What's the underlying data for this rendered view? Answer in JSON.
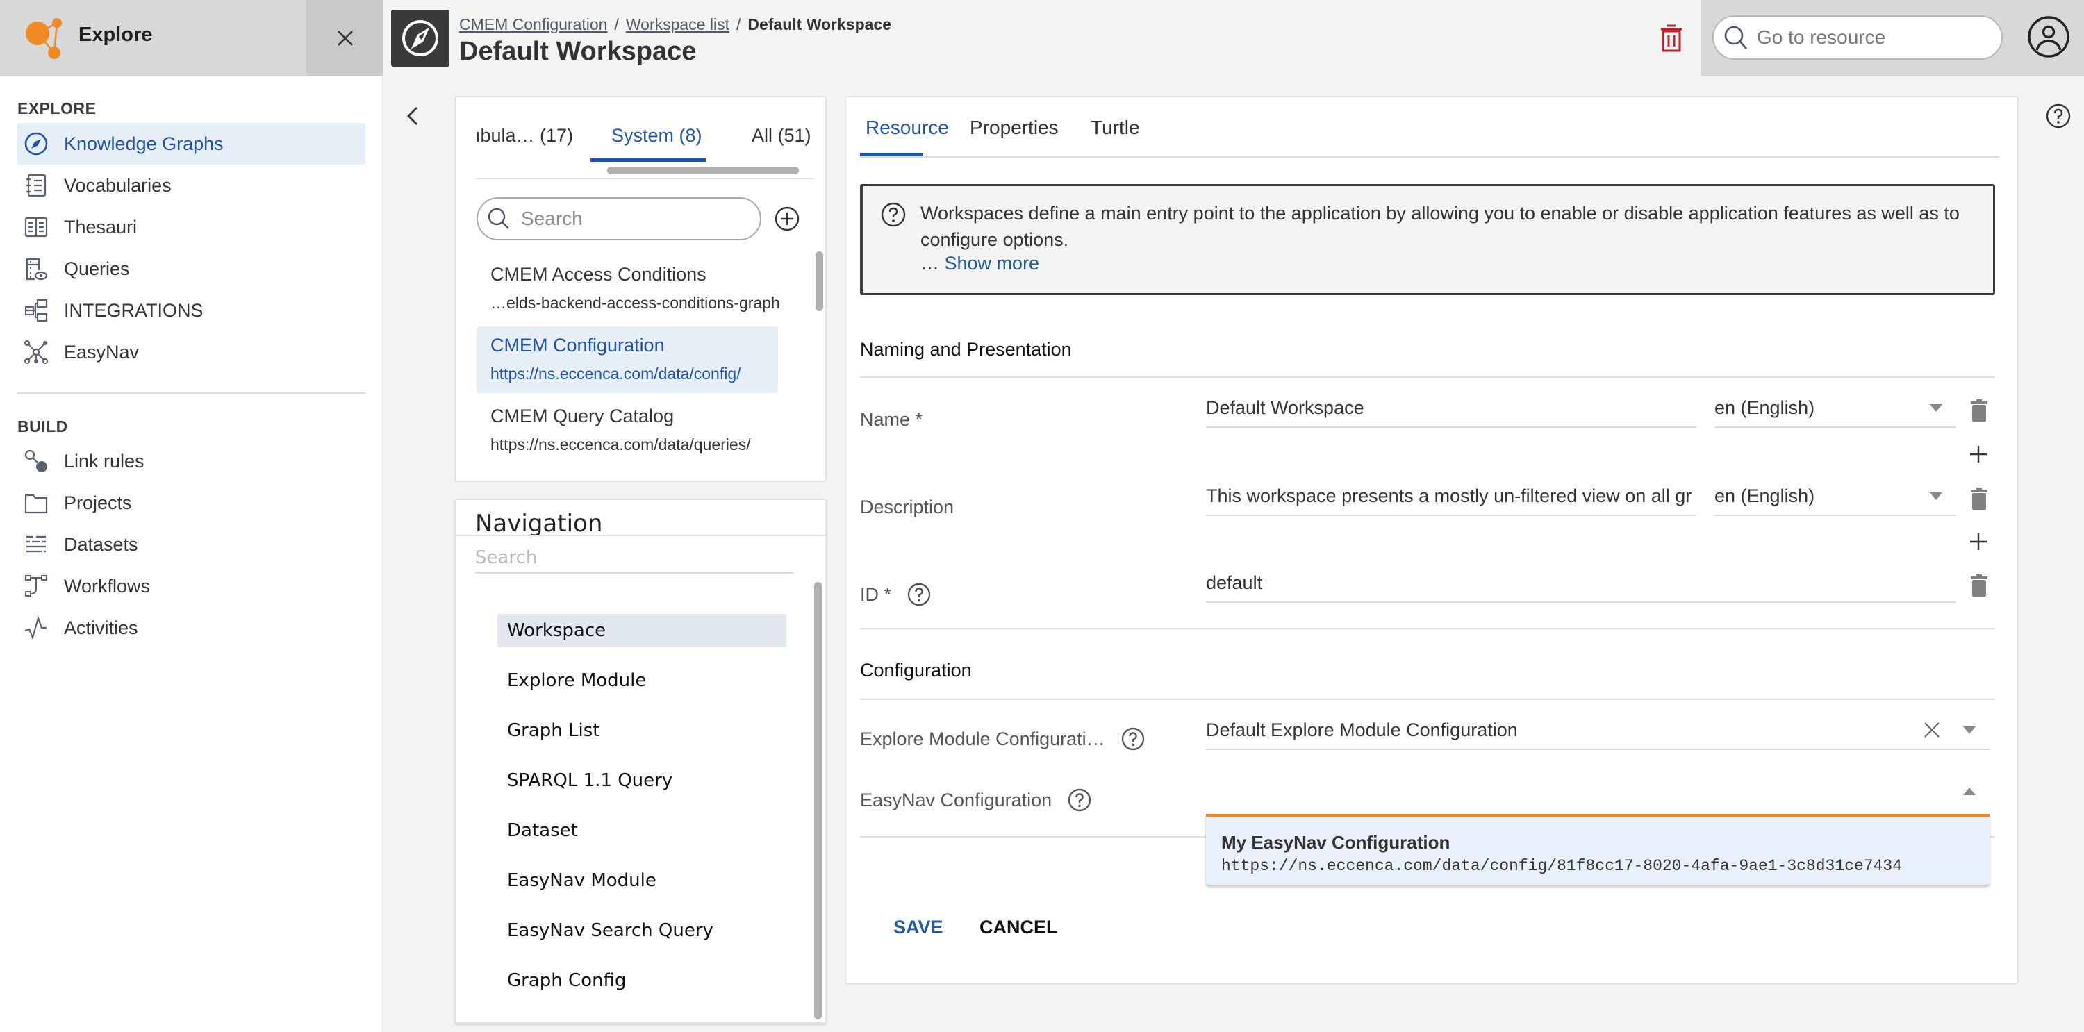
{
  "app": {
    "name": "Explore",
    "accent_color": "#f08a24",
    "primary_color": "#2453a4"
  },
  "sidebar": {
    "sections": [
      {
        "title": "EXPLORE",
        "items": [
          {
            "label": "Knowledge Graphs",
            "icon": "compass-icon",
            "active": true
          },
          {
            "label": "Vocabularies",
            "icon": "notebook-icon"
          },
          {
            "label": "Thesauri",
            "icon": "book-columns-icon"
          },
          {
            "label": "Queries",
            "icon": "query-eye-icon"
          },
          {
            "label": "INTEGRATIONS",
            "icon": "integrations-icon"
          },
          {
            "label": "EasyNav",
            "icon": "graph-network-icon"
          }
        ]
      },
      {
        "title": "BUILD",
        "items": [
          {
            "label": "Link rules",
            "icon": "link-rules-icon"
          },
          {
            "label": "Projects",
            "icon": "folder-icon"
          },
          {
            "label": "Datasets",
            "icon": "dataset-lines-icon"
          },
          {
            "label": "Workflows",
            "icon": "workflow-icon"
          },
          {
            "label": "Activities",
            "icon": "activity-pulse-icon"
          }
        ]
      }
    ]
  },
  "header": {
    "breadcrumb": [
      "CMEM Configuration",
      "Workspace list",
      "Default Workspace"
    ],
    "separator": "/",
    "title": "Default Workspace",
    "search_placeholder": "Go to resource"
  },
  "graph_list": {
    "tabs": [
      {
        "label": "ıbula…  (17)"
      },
      {
        "label": "System (8)",
        "active": true
      },
      {
        "label": "All (51)"
      }
    ],
    "search_placeholder": "Search",
    "items": [
      {
        "title": "CMEM Access Conditions",
        "uri": "…elds-backend-access-conditions-graph"
      },
      {
        "title": "CMEM Configuration",
        "uri": "https://ns.eccenca.com/data/config/",
        "active": true
      },
      {
        "title": "CMEM Query Catalog",
        "uri": "https://ns.eccenca.com/data/queries/"
      }
    ]
  },
  "navigation": {
    "title": "Navigation",
    "search_placeholder": "Search",
    "items": [
      {
        "label": "Workspace",
        "active": true
      },
      {
        "label": "Explore Module"
      },
      {
        "label": "Graph List"
      },
      {
        "label": "SPARQL 1.1 Query"
      },
      {
        "label": "Dataset"
      },
      {
        "label": "EasyNav Module"
      },
      {
        "label": "EasyNav Search Query"
      },
      {
        "label": "Graph Config"
      }
    ]
  },
  "editor": {
    "tabs": [
      {
        "label": "Resource",
        "active": true
      },
      {
        "label": "Properties"
      },
      {
        "label": "Turtle"
      }
    ],
    "info": {
      "text": "Workspaces define a main entry point to the application by allowing you to enable or disable application features as well as to configure options.",
      "ellipsis": "… ",
      "show_more": "Show more"
    },
    "sections": {
      "naming": "Naming and Presentation",
      "configuration": "Configuration"
    },
    "fields": {
      "name": {
        "label": "Name *",
        "value": "Default Workspace",
        "lang": "en (English)"
      },
      "description": {
        "label": "Description",
        "value": "This workspace presents a mostly un-filtered view on all gr",
        "lang": "en (English)"
      },
      "id": {
        "label": "ID *",
        "value": "default"
      },
      "explore_module": {
        "label": "Explore Module Configurati…",
        "value": "Default Explore Module Configuration"
      },
      "easynav": {
        "label": "EasyNav Configuration",
        "value": ""
      }
    },
    "dropdown_options": [
      {
        "title": "My EasyNav Configuration",
        "uri": "https://ns.eccenca.com/data/config/81f8cc17-8020-4afa-9ae1-3c8d31ce7434"
      }
    ],
    "save_label": "SAVE",
    "cancel_label": "CANCEL"
  }
}
